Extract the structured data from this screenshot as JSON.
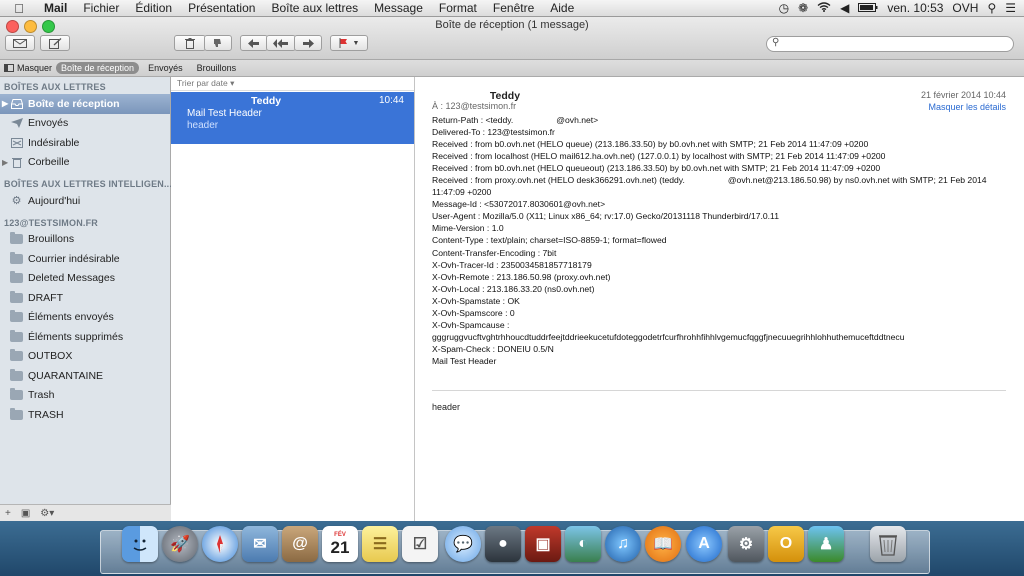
{
  "menubar": {
    "app": "Mail",
    "items": [
      "Fichier",
      "Édition",
      "Présentation",
      "Boîte aux lettres",
      "Message",
      "Format",
      "Fenêtre",
      "Aide"
    ],
    "clock": "ven. 10:53",
    "user": "OVH"
  },
  "window": {
    "title": "Boîte de réception (1 message)"
  },
  "favorites": {
    "hide": "Masquer",
    "items": [
      "Boîte de réception",
      "Envoyés",
      "Brouillons"
    ]
  },
  "sidebar": {
    "section_mailboxes": "BOÎTES AUX LETTRES",
    "mailboxes": [
      "Boîte de réception",
      "Envoyés",
      "Indésirable",
      "Corbeille"
    ],
    "section_smart": "BOÎTES AUX LETTRES INTELLIGEN...",
    "smart": [
      "Aujourd'hui"
    ],
    "section_account": "123@TESTSIMON.FR",
    "folders": [
      "Brouillons",
      "Courrier indésirable",
      "Deleted Messages",
      "DRAFT",
      "Éléments envoyés",
      "Éléments supprimés",
      "OUTBOX",
      "QUARANTAINE",
      "Trash",
      "TRASH"
    ]
  },
  "message_list": {
    "sort_label": "Trier par date",
    "messages": [
      {
        "from": "Teddy",
        "time": "10:44",
        "subject": "Mail Test Header",
        "preview": "header"
      }
    ]
  },
  "viewer": {
    "from": "Teddy",
    "date": "21 février 2014 10:44",
    "to": "À : 123@testsimon.fr",
    "hide_details": "Masquer les détails",
    "headers": [
      "Return-Path : <teddy.                  @ovh.net>",
      "Delivered-To : 123@testsimon.fr",
      "Received : from b0.ovh.net (HELO queue) (213.186.33.50) by b0.ovh.net with SMTP; 21 Feb 2014 11:47:09 +0200",
      "Received : from localhost (HELO mail612.ha.ovh.net) (127.0.0.1) by localhost with SMTP; 21 Feb 2014 11:47:09 +0200",
      "Received : from b0.ovh.net (HELO queueout) (213.186.33.50) by b0.ovh.net with SMTP; 21 Feb 2014 11:47:09 +0200",
      "Received : from proxy.ovh.net (HELO desk366291.ovh.net) (teddy.                  @ovh.net@213.186.50.98) by ns0.ovh.net with SMTP; 21 Feb 2014 11:47:09 +0200",
      "Message-Id : <53072017.8030601@ovh.net>",
      "User-Agent : Mozilla/5.0 (X11; Linux x86_64; rv:17.0) Gecko/20131118 Thunderbird/17.0.11",
      "Mime-Version : 1.0",
      "Content-Type : text/plain; charset=ISO-8859-1; format=flowed",
      "Content-Transfer-Encoding : 7bit",
      "X-Ovh-Tracer-Id : 2350034581857718179",
      "X-Ovh-Remote : 213.186.50.98 (proxy.ovh.net)",
      "X-Ovh-Local : 213.186.33.20 (ns0.ovh.net)",
      "X-Ovh-Spamstate : OK",
      "X-Ovh-Spamscore : 0",
      "X-Ovh-Spamcause :",
      "gggruggvucftvghtrhhoucdtuddrfeejtddrieekucetufdoteggodetrfcurfhrohhfihhlvgemucfqggfjnecuuegrihhlohhuthemuceftddtnecu",
      "X-Spam-Check : DONEIU 0.5/N",
      "Mail Test Header"
    ],
    "body": "header"
  },
  "dock": {
    "apps": [
      "finder",
      "launchpad",
      "safari",
      "mail",
      "contacts",
      "calendar",
      "notes",
      "reminders",
      "messages",
      "facetime",
      "photo-booth",
      "iphoto",
      "itunes",
      "ibooks",
      "app-store",
      "system-preferences",
      "outlook",
      "messenger",
      "trash"
    ],
    "calendar_day": "21",
    "calendar_month": "FÉV"
  }
}
